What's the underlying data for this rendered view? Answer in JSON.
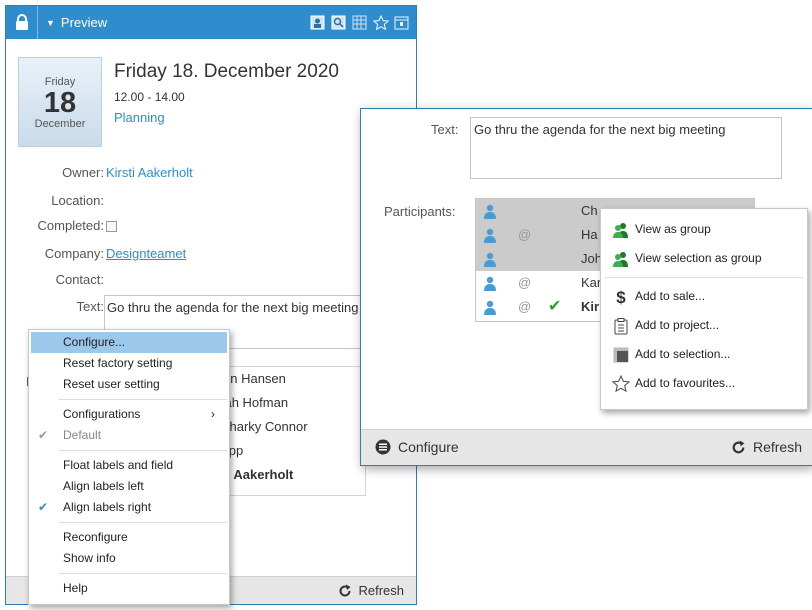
{
  "left_panel": {
    "title": "Preview",
    "date": {
      "weekday": "Friday",
      "day": "18",
      "month": "December"
    },
    "appointment_title": "Friday 18. December 2020",
    "time": "12.00 - 14.00",
    "type": "Planning",
    "labels": {
      "owner": "Owner:",
      "location": "Location:",
      "completed": "Completed:",
      "company": "Company:",
      "contact": "Contact:",
      "text": "Text:",
      "participants_partial": "P"
    },
    "owner": "Kirsti Aakerholt",
    "company": "Designteamet",
    "text": "Go thru the agenda for the next big meeting",
    "participants": [
      "stian Hansen",
      "nnah Hofman",
      "n Sharky Connor",
      "Klopp",
      "rsti Aakerholt"
    ],
    "refresh_label": "Refresh"
  },
  "left_menu": {
    "items": [
      {
        "label": "Configure...",
        "state": "highlighted"
      },
      {
        "label": "Reset factory setting"
      },
      {
        "label": "Reset user setting"
      },
      {
        "sep": true
      },
      {
        "label": "Configurations",
        "submenu": true
      },
      {
        "label": "Default",
        "check": true,
        "disabled": true
      },
      {
        "sep": true
      },
      {
        "label": "Float labels and field"
      },
      {
        "label": "Align labels left"
      },
      {
        "label": "Align labels right",
        "check": true
      },
      {
        "sep": true
      },
      {
        "label": "Reconfigure"
      },
      {
        "label": "Show info"
      },
      {
        "sep": true
      },
      {
        "label": "Help"
      }
    ]
  },
  "right_panel": {
    "text_label": "Text:",
    "text": "Go thru the agenda for the next big meeting",
    "participants_label": "Participants:",
    "participants": [
      {
        "name": "Ch",
        "at": false,
        "ok": false,
        "bold": false,
        "selected": true
      },
      {
        "name": "Ha",
        "at": true,
        "ok": false,
        "bold": false,
        "selected": true
      },
      {
        "name": "Joh",
        "at": false,
        "ok": false,
        "bold": false,
        "selected": true
      },
      {
        "name": "Kar",
        "at": true,
        "ok": false,
        "bold": false,
        "selected": false
      },
      {
        "name": "Kir",
        "at": true,
        "ok": true,
        "bold": true,
        "selected": false
      }
    ],
    "configure_label": "Configure",
    "refresh_label": "Refresh"
  },
  "right_menu": {
    "items": [
      {
        "label": "View as group",
        "icon": "group-person-icon"
      },
      {
        "label": "View selection as group",
        "icon": "group-person-icon"
      },
      {
        "sep": true
      },
      {
        "label": "Add to sale...",
        "icon": "dollar-icon"
      },
      {
        "label": "Add to project...",
        "icon": "clipboard-icon"
      },
      {
        "label": "Add to selection...",
        "icon": "selection-icon"
      },
      {
        "label": "Add to favourites...",
        "icon": "star-icon"
      }
    ]
  },
  "colors": {
    "accent": "#2f8ccd",
    "check_green": "#2aa52a",
    "menu_highlight": "#9cc8eb"
  }
}
